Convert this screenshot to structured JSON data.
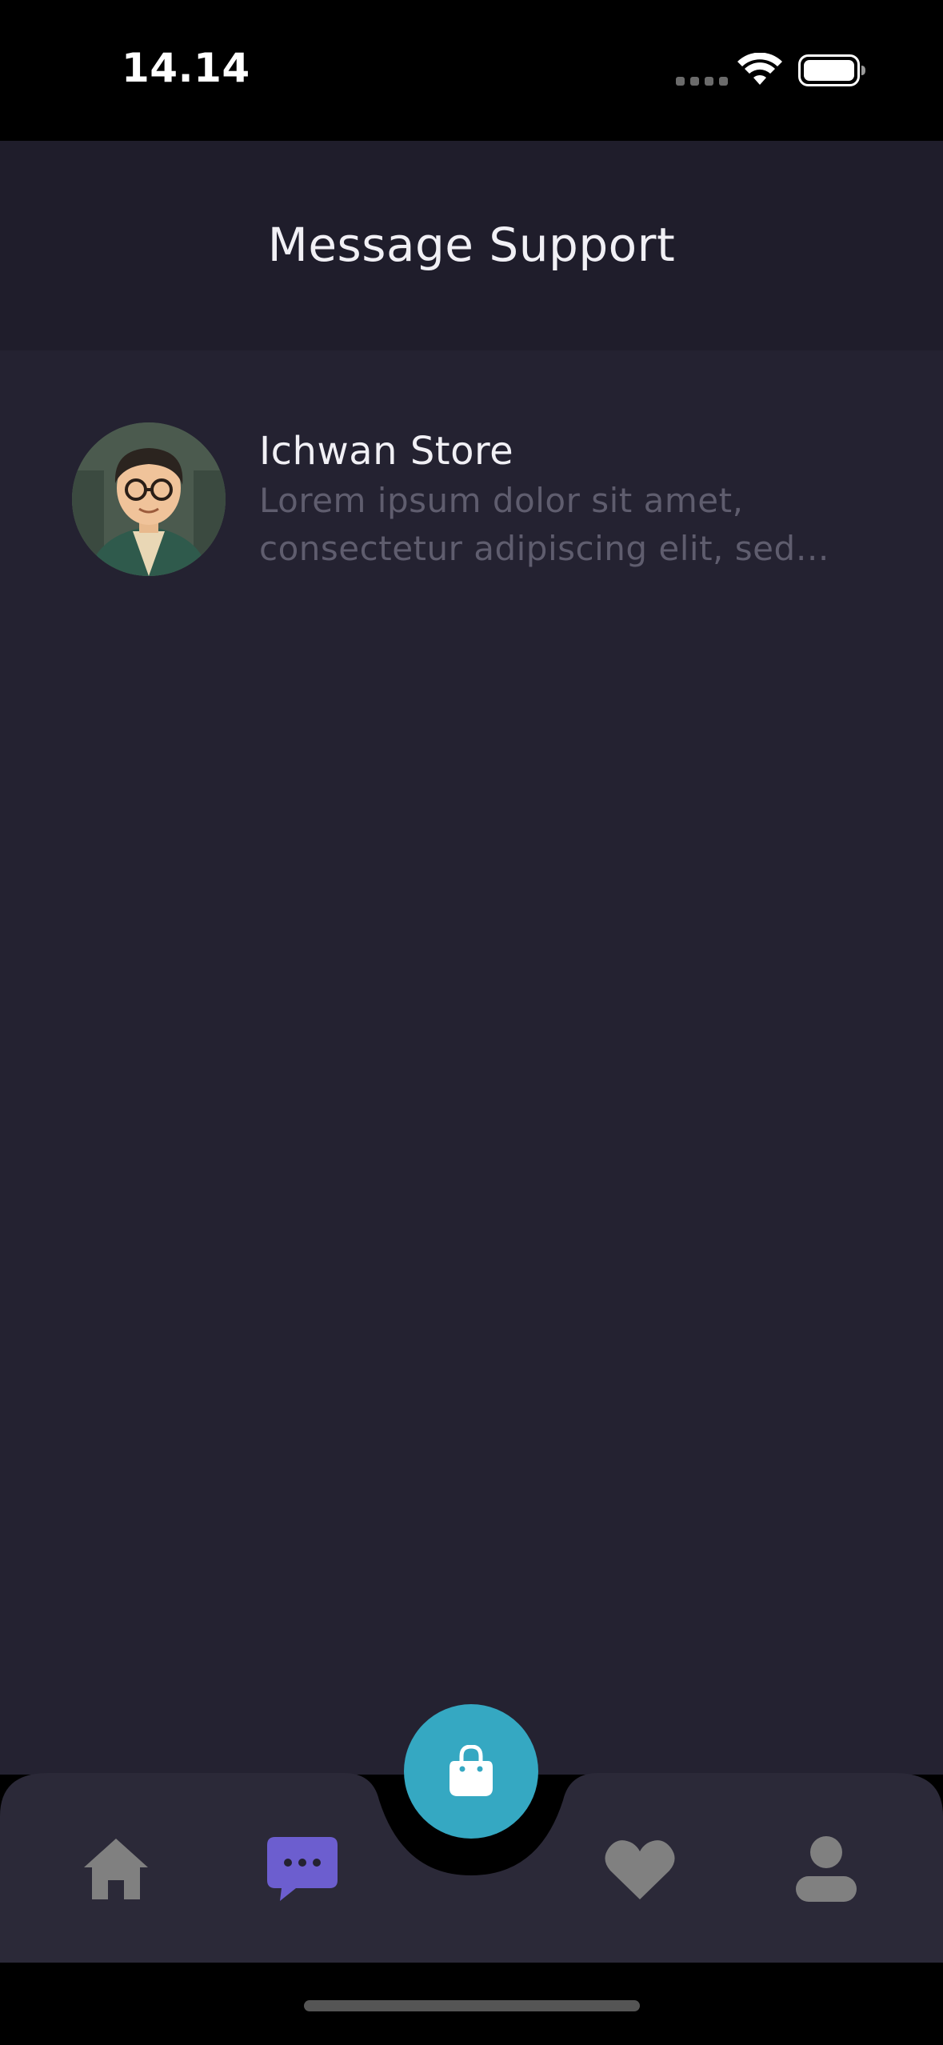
{
  "status_bar": {
    "time": "14.14",
    "icons": [
      "cellular-dots-icon",
      "wifi-icon",
      "battery-icon"
    ]
  },
  "header": {
    "title": "Message Support"
  },
  "chats": [
    {
      "name": "Ichwan Store",
      "preview": "Lorem ipsum dolor sit amet, consectetur adipiscing elit, sed d...",
      "avatar": "avatar-illustration"
    }
  ],
  "bottom_nav": {
    "items": [
      {
        "name": "home",
        "icon": "home-icon",
        "active": false
      },
      {
        "name": "chat",
        "icon": "chat-icon",
        "active": true
      },
      {
        "name": "cart",
        "icon": "shopping-bag-icon",
        "active": false
      },
      {
        "name": "wishlist",
        "icon": "heart-icon",
        "active": false
      },
      {
        "name": "profile",
        "icon": "person-icon",
        "active": false
      }
    ]
  },
  "colors": {
    "header_bg": "#1f1d2b",
    "content_bg": "#242231",
    "nav_bg": "#2b2938",
    "accent": "#6c5ecf",
    "fab": "#35a8c2",
    "inactive_icon": "#808080"
  }
}
